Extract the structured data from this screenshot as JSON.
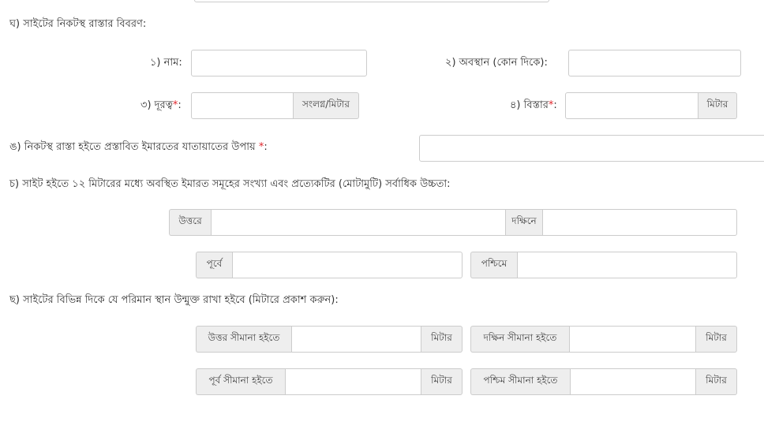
{
  "sections": {
    "gha_title": "ঘ) সাইটের নিকটস্থ রাস্তার বিবরণ:",
    "name_label": "১) নাম:",
    "location_label": "২) অবস্থান (কোন দিকে):",
    "distance_label": "৩) দূরত্ব",
    "distance_unit": "সংলগ্ন/মিটার",
    "width_label": "৪) বিস্তার",
    "width_unit": "মিটার",
    "umo_title": "ঙ) নিকটস্থ রাস্তা হইতে প্রস্তাবিত ইমারতের যাতায়াতের উপায়",
    "cha_title": "চ) সাইট হইতে ১২ মিটারের মধ্যে অবস্থিত ইমারত সমূহের সংখ্যা এবং প্রত্যেকটির (মোটামুটি) সর্বাধিক উচ্চতা:",
    "north": "উত্তরে",
    "south": "দক্ষিনে",
    "east": "পূর্বে",
    "west": "পশ্চিমে",
    "chha_title": "ছ) সাইটের বিভিন্ন দিকে যে পরিমান স্থান উন্মুক্ত রাখা হইবে (মিটারে প্রকাশ করুন):",
    "north_border": "উত্তর সীমানা হইতে",
    "south_border": "দক্ষিন সীমানা হইতে",
    "east_border": "পূর্ব সীমানা হইতে",
    "west_border": "পশ্চিম সীমানা হইতে",
    "meter": "মিটার",
    "required_mark": "*",
    "colon": ":"
  },
  "colors": {
    "required": "#e0262c",
    "addon_bg": "#eeeeee",
    "border": "#cccccc"
  }
}
